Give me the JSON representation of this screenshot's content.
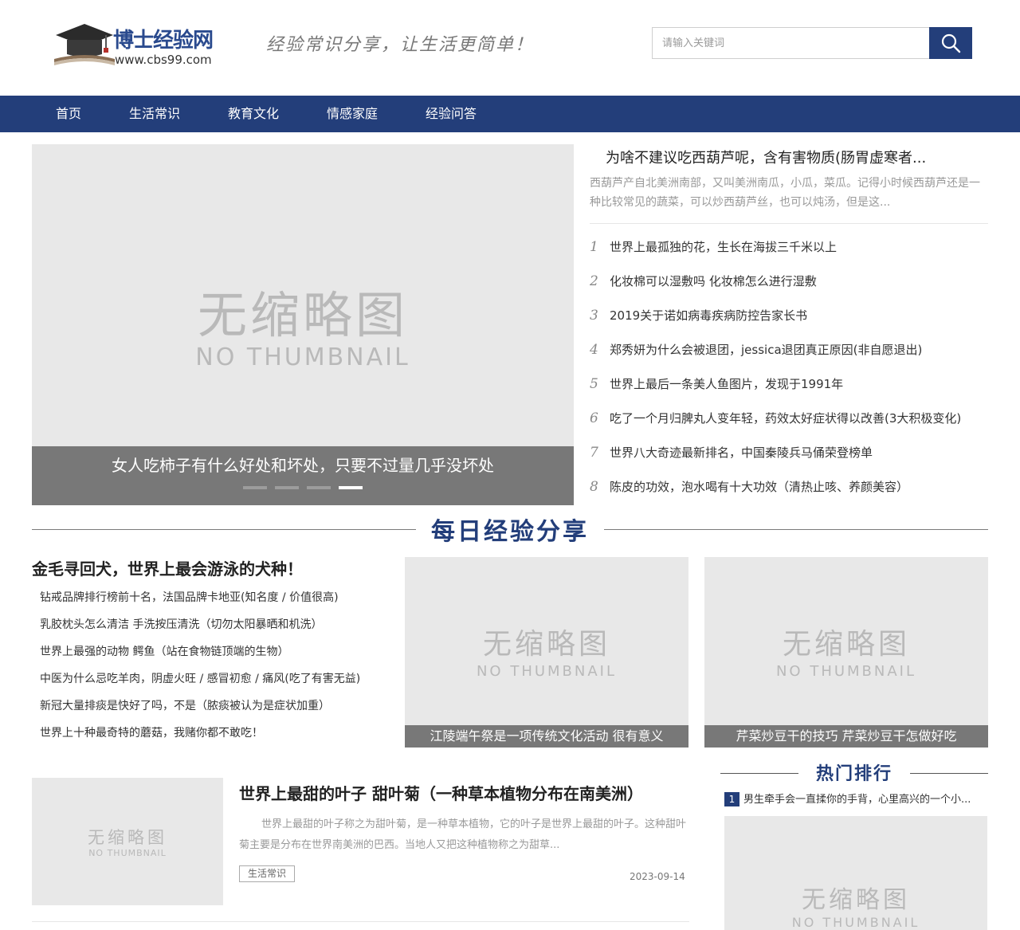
{
  "header": {
    "logo_title": "博士经验网",
    "logo_url": "www.cbs99.com",
    "slogan": "经验常识分享，让生活更简单！",
    "search_placeholder": "请输入关键词"
  },
  "nav": {
    "items": [
      "首页",
      "生活常识",
      "教育文化",
      "情感家庭",
      "经验问答"
    ]
  },
  "placeholder": {
    "cn": "无缩略图",
    "en": "NO THUMBNAIL"
  },
  "slider": {
    "caption": "女人吃柿子有什么好处和坏处，只要不过量几乎没坏处",
    "dot_count": 4,
    "active_index": 3
  },
  "headline": {
    "title": "为啥不建议吃西葫芦呢，含有害物质(肠胃虚寒者...",
    "desc": "西葫芦产自北美洲南部，又叫美洲南瓜，小瓜，菜瓜。记得小时候西葫芦还是一种比较常见的蔬菜，可以炒西葫芦丝，也可以炖汤，但是这..."
  },
  "ranking": [
    {
      "num": "1",
      "text": "世界上最孤独的花，生长在海拔三千米以上"
    },
    {
      "num": "2",
      "text": "化妆棉可以湿敷吗 化妆棉怎么进行湿敷"
    },
    {
      "num": "3",
      "text": "2019关于诺如病毒疾病防控告家长书"
    },
    {
      "num": "4",
      "text": "郑秀妍为什么会被退团，jessica退团真正原因(非自愿退出)"
    },
    {
      "num": "5",
      "text": "世界上最后一条美人鱼图片，发现于1991年"
    },
    {
      "num": "6",
      "text": "吃了一个月归脾丸人变年轻，药效太好症状得以改善(3大积极变化)"
    },
    {
      "num": "7",
      "text": "世界八大奇迹最新排名，中国秦陵兵马俑荣登榜单"
    },
    {
      "num": "8",
      "text": "陈皮的功效，泡水喝有十大功效（清热止咳、养颜美容）"
    }
  ],
  "daily": {
    "section_title": "每日经验分享",
    "main_title": "金毛寻回犬，世界上最会游泳的犬种！",
    "items": [
      "钻戒品牌排行榜前十名，法国品牌卡地亚(知名度 / 价值很高)",
      "乳胶枕头怎么清洁 手洗按压清洗（切勿太阳暴晒和机洗）",
      "世界上最强的动物 鳄鱼（站在食物链顶端的生物）",
      "中医为什么忌吃羊肉，阴虚火旺 / 感冒初愈 / 痛风(吃了有害无益)",
      "新冠大量排痰是快好了吗，不是（脓痰被认为是症状加重）",
      "世界上十种最奇特的蘑菇，我赌你都不敢吃！"
    ],
    "cards": [
      {
        "caption": "江陵端午祭是一项传统文化活动 很有意义"
      },
      {
        "caption": "芹菜炒豆干的技巧 芹菜炒豆干怎做好吃"
      }
    ]
  },
  "article": {
    "title": "世界上最甜的叶子 甜叶菊（一种草本植物分布在南美洲）",
    "desc": "世界上最甜的叶子称之为甜叶菊，是一种草本植物，它的叶子是世界上最甜的叶子。这种甜叶菊主要是分布在世界南美洲的巴西。当地人又把这种植物称之为甜草...",
    "tag": "生活常识",
    "date": "2023-09-14"
  },
  "hot": {
    "title": "热门排行",
    "item_num": "1",
    "item_text": "男生牵手会一直揉你的手背，心里高兴的一个小..."
  },
  "colors": {
    "brand": "#233e7a",
    "placeholder_bg": "#e8e8e8",
    "caption_bg": "#6e6e6e"
  }
}
